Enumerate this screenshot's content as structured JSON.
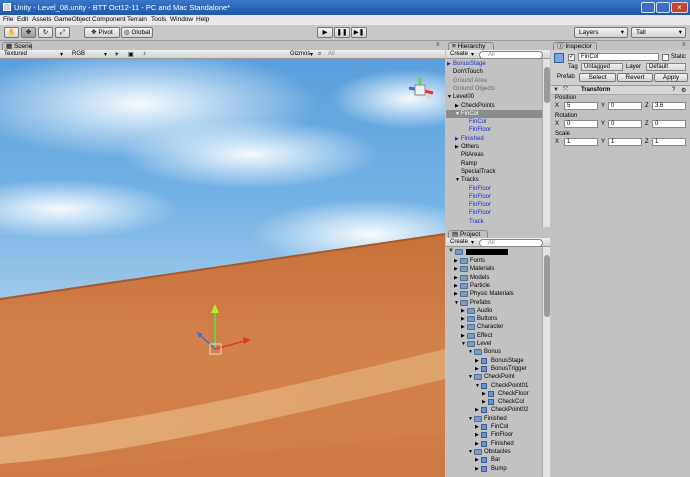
{
  "window": {
    "title": "Unity - Level_08.unity - BTT Oct12-11 - PC and Mac Standalone*"
  },
  "menu": [
    "File",
    "Edit",
    "Assets",
    "GameObject",
    "Component",
    "Terrain",
    "Tools",
    "Window",
    "Help"
  ],
  "toolbar": {
    "pivot": "Pivot",
    "global": "Global",
    "layers": "Layers",
    "layout": "Tall"
  },
  "scene": {
    "tab": "Scene",
    "render_mode": "Textured",
    "color_mode": "RGB",
    "gizmos": "Gizmos",
    "search": "All"
  },
  "hierarchy": {
    "tab": "Hierarchy",
    "create": "Create",
    "search": "All",
    "items": [
      {
        "label": "BonusStage",
        "indent": 0,
        "style": "blue"
      },
      {
        "label": "Don'tTouch",
        "indent": 0,
        "style": "normal"
      },
      {
        "label": "Ground Area",
        "indent": 0,
        "style": "gray"
      },
      {
        "label": "Ground Objects",
        "indent": 0,
        "style": "gray"
      },
      {
        "label": "Level00",
        "indent": 0,
        "style": "normal"
      },
      {
        "label": "CheckPoints",
        "indent": 1,
        "style": "normal"
      },
      {
        "label": "FinCol",
        "indent": 1,
        "style": "selected"
      },
      {
        "label": "FinCol",
        "indent": 2,
        "style": "blue"
      },
      {
        "label": "FinFloor",
        "indent": 2,
        "style": "blue"
      },
      {
        "label": "Finished",
        "indent": 1,
        "style": "blue"
      },
      {
        "label": "Others",
        "indent": 1,
        "style": "normal"
      },
      {
        "label": "PitAreas",
        "indent": 1,
        "style": "normal"
      },
      {
        "label": "Ramp",
        "indent": 1,
        "style": "normal"
      },
      {
        "label": "SpecialTrack",
        "indent": 1,
        "style": "normal"
      },
      {
        "label": "Tracks",
        "indent": 1,
        "style": "normal"
      },
      {
        "label": "FinFloor",
        "indent": 2,
        "style": "blue"
      },
      {
        "label": "FinFloor",
        "indent": 2,
        "style": "blue"
      },
      {
        "label": "FinFloor",
        "indent": 2,
        "style": "blue"
      },
      {
        "label": "FinFloor",
        "indent": 2,
        "style": "blue"
      },
      {
        "label": "Track",
        "indent": 2,
        "style": "blue"
      }
    ]
  },
  "project": {
    "tab": "Project",
    "create": "Create",
    "search": "All",
    "items": [
      {
        "label": "Fonts",
        "indent": 1,
        "kind": "folder"
      },
      {
        "label": "Materials",
        "indent": 1,
        "kind": "folder"
      },
      {
        "label": "Models",
        "indent": 1,
        "kind": "folder"
      },
      {
        "label": "Particle",
        "indent": 1,
        "kind": "folder"
      },
      {
        "label": "Physic Materials",
        "indent": 1,
        "kind": "folder"
      },
      {
        "label": "Prefabs",
        "indent": 1,
        "kind": "folder"
      },
      {
        "label": "Audio",
        "indent": 2,
        "kind": "folder"
      },
      {
        "label": "Buttons",
        "indent": 2,
        "kind": "folder"
      },
      {
        "label": "Character",
        "indent": 2,
        "kind": "folder"
      },
      {
        "label": "Effect",
        "indent": 2,
        "kind": "folder"
      },
      {
        "label": "Level",
        "indent": 2,
        "kind": "folder"
      },
      {
        "label": "Bonus",
        "indent": 3,
        "kind": "folder"
      },
      {
        "label": "BonusStage",
        "indent": 4,
        "kind": "prefab"
      },
      {
        "label": "BonusTrigger",
        "indent": 4,
        "kind": "prefab"
      },
      {
        "label": "CheckPoint",
        "indent": 3,
        "kind": "folder"
      },
      {
        "label": "CheckPoint01",
        "indent": 4,
        "kind": "prefab"
      },
      {
        "label": "CheckFloor",
        "indent": 5,
        "kind": "prefab"
      },
      {
        "label": "CheckCol",
        "indent": 5,
        "kind": "prefab"
      },
      {
        "label": "CheckPoint02",
        "indent": 4,
        "kind": "prefab"
      },
      {
        "label": "Finished",
        "indent": 3,
        "kind": "folder"
      },
      {
        "label": "FinCol",
        "indent": 4,
        "kind": "prefab"
      },
      {
        "label": "FinFloor",
        "indent": 4,
        "kind": "prefab"
      },
      {
        "label": "Finished",
        "indent": 4,
        "kind": "prefab"
      },
      {
        "label": "Obstacles",
        "indent": 3,
        "kind": "folder"
      },
      {
        "label": "Bar",
        "indent": 4,
        "kind": "prefab"
      },
      {
        "label": "Bump",
        "indent": 4,
        "kind": "prefab"
      }
    ]
  },
  "inspector": {
    "tab": "Inspector",
    "object_name": "FinCol",
    "static": "Static",
    "tag_label": "Tag",
    "tag_value": "Untagged",
    "layer_label": "Layer",
    "layer_value": "Default",
    "prefab_label": "Prefab",
    "select": "Select",
    "revert": "Revert",
    "apply": "Apply",
    "component": "Transform",
    "position_label": "Position",
    "rotation_label": "Rotation",
    "scale_label": "Scale",
    "position": {
      "x": "5",
      "y": "0",
      "z": "3.6"
    },
    "rotation": {
      "x": "0",
      "y": "0",
      "z": "0"
    },
    "scale": {
      "x": "1",
      "y": "1",
      "z": "1"
    }
  }
}
